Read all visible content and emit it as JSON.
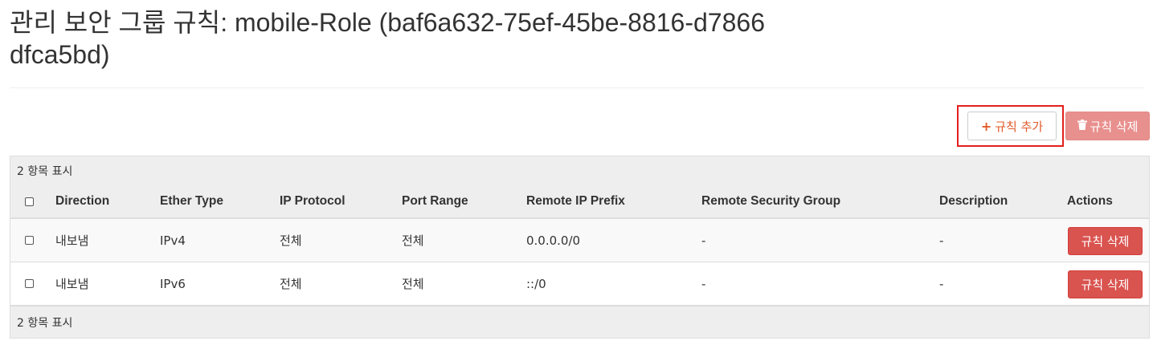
{
  "page": {
    "title": "관리 보안 그룹 규칙: mobile-Role (baf6a632-75ef-45be-8816-d7866dfca5bd)"
  },
  "toolbar": {
    "add_icon": "+",
    "add_label": "규칙 추가",
    "delete_icon": "trash-icon",
    "delete_label": "규칙 삭제",
    "accent_color": "#e05a2b",
    "danger_color": "#d9534f",
    "highlight_color": "#e41e1e"
  },
  "table": {
    "summary_top": "2 항목 표시",
    "summary_bottom": "2 항목 표시",
    "columns": [
      "Direction",
      "Ether Type",
      "IP Protocol",
      "Port Range",
      "Remote IP Prefix",
      "Remote Security Group",
      "Description",
      "Actions"
    ],
    "rows": [
      {
        "direction": "내보냄",
        "ether_type": "IPv4",
        "ip_protocol": "전체",
        "port_range": "전체",
        "remote_ip_prefix": "0.0.0.0/0",
        "remote_security_group": "-",
        "description": "-",
        "action": "규칙 삭제"
      },
      {
        "direction": "내보냄",
        "ether_type": "IPv6",
        "ip_protocol": "전체",
        "port_range": "전체",
        "remote_ip_prefix": "::/0",
        "remote_security_group": "-",
        "description": "-",
        "action": "규칙 삭제"
      }
    ]
  }
}
